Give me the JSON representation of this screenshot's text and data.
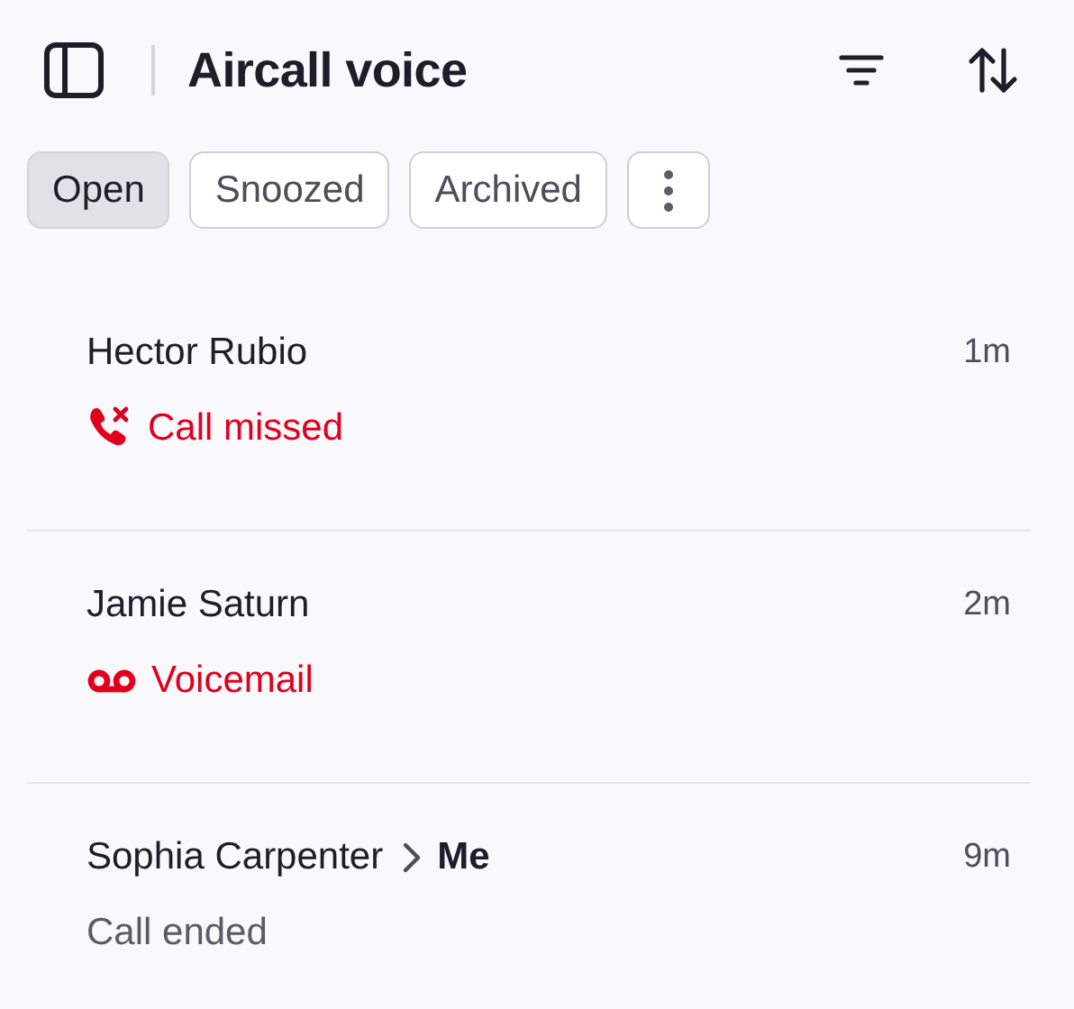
{
  "header": {
    "title": "Aircall voice"
  },
  "tabs": [
    {
      "label": "Open",
      "selected": true
    },
    {
      "label": "Snoozed",
      "selected": false
    },
    {
      "label": "Archived",
      "selected": false
    }
  ],
  "calls": [
    {
      "name": "Hector Rubio",
      "time": "1m",
      "status": {
        "kind": "missed",
        "text": "Call missed"
      }
    },
    {
      "name": "Jamie Saturn",
      "time": "2m",
      "status": {
        "kind": "voicemail",
        "text": "Voicemail"
      }
    },
    {
      "name": "Sophia Carpenter",
      "to": "Me",
      "time": "9m",
      "status": {
        "kind": "ended",
        "text": "Call ended"
      }
    }
  ]
}
